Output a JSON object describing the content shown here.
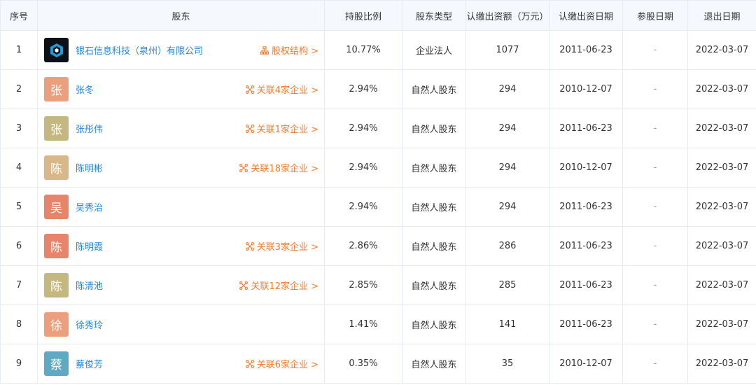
{
  "headers": {
    "index": "序号",
    "holder": "股东",
    "ratio": "持股比例",
    "type": "股东类型",
    "amount": "认缴出资额（万元）",
    "sub_date": "认缴出资日期",
    "join_date": "参股日期",
    "exit_date": "退出日期"
  },
  "colors": {
    "link": "#1f84e0",
    "relation": "#f47a2d"
  },
  "rows": [
    {
      "index": "1",
      "avatar": "",
      "avatar_color": "#0b1116",
      "name": "银石信息科技（泉州）有限公司",
      "relation": "股权结构 >",
      "relation_icon": "structure-icon",
      "ratio": "10.77%",
      "type": "企业法人",
      "amount": "1077",
      "sub_date": "2011-06-23",
      "join_date": "-",
      "exit_date": "2022-03-07"
    },
    {
      "index": "2",
      "avatar": "张",
      "avatar_color": "#ec9f7c",
      "name": "张冬",
      "relation": "关联4家企业 >",
      "relation_icon": "network-icon",
      "ratio": "2.94%",
      "type": "自然人股东",
      "amount": "294",
      "sub_date": "2010-12-07",
      "join_date": "-",
      "exit_date": "2022-03-07"
    },
    {
      "index": "3",
      "avatar": "张",
      "avatar_color": "#c4b880",
      "name": "张彤伟",
      "relation": "关联1家企业 >",
      "relation_icon": "network-icon",
      "ratio": "2.94%",
      "type": "自然人股东",
      "amount": "294",
      "sub_date": "2011-06-23",
      "join_date": "-",
      "exit_date": "2022-03-07"
    },
    {
      "index": "4",
      "avatar": "陈",
      "avatar_color": "#d8b889",
      "name": "陈明彬",
      "relation": "关联18家企业 >",
      "relation_icon": "network-icon",
      "ratio": "2.94%",
      "type": "自然人股东",
      "amount": "294",
      "sub_date": "2010-12-07",
      "join_date": "-",
      "exit_date": "2022-03-07"
    },
    {
      "index": "5",
      "avatar": "吴",
      "avatar_color": "#e8846b",
      "name": "吴秀治",
      "relation": "",
      "relation_icon": "",
      "ratio": "2.94%",
      "type": "自然人股东",
      "amount": "294",
      "sub_date": "2011-06-23",
      "join_date": "-",
      "exit_date": "2022-03-07"
    },
    {
      "index": "6",
      "avatar": "陈",
      "avatar_color": "#e8846b",
      "name": "陈明霞",
      "relation": "关联3家企业 >",
      "relation_icon": "network-icon",
      "ratio": "2.86%",
      "type": "自然人股东",
      "amount": "286",
      "sub_date": "2011-06-23",
      "join_date": "-",
      "exit_date": "2022-03-07"
    },
    {
      "index": "7",
      "avatar": "陈",
      "avatar_color": "#c4b880",
      "name": "陈清池",
      "relation": "关联12家企业 >",
      "relation_icon": "network-icon",
      "ratio": "2.85%",
      "type": "自然人股东",
      "amount": "285",
      "sub_date": "2011-06-23",
      "join_date": "-",
      "exit_date": "2022-03-07"
    },
    {
      "index": "8",
      "avatar": "徐",
      "avatar_color": "#ec9f7c",
      "name": "徐秀玲",
      "relation": "",
      "relation_icon": "",
      "ratio": "1.41%",
      "type": "自然人股东",
      "amount": "141",
      "sub_date": "2011-06-23",
      "join_date": "-",
      "exit_date": "2022-03-07"
    },
    {
      "index": "9",
      "avatar": "蔡",
      "avatar_color": "#5fa9c2",
      "name": "蔡俊芳",
      "relation": "关联6家企业 >",
      "relation_icon": "network-icon",
      "ratio": "0.35%",
      "type": "自然人股东",
      "amount": "35",
      "sub_date": "2010-12-07",
      "join_date": "-",
      "exit_date": "2022-03-07"
    }
  ]
}
